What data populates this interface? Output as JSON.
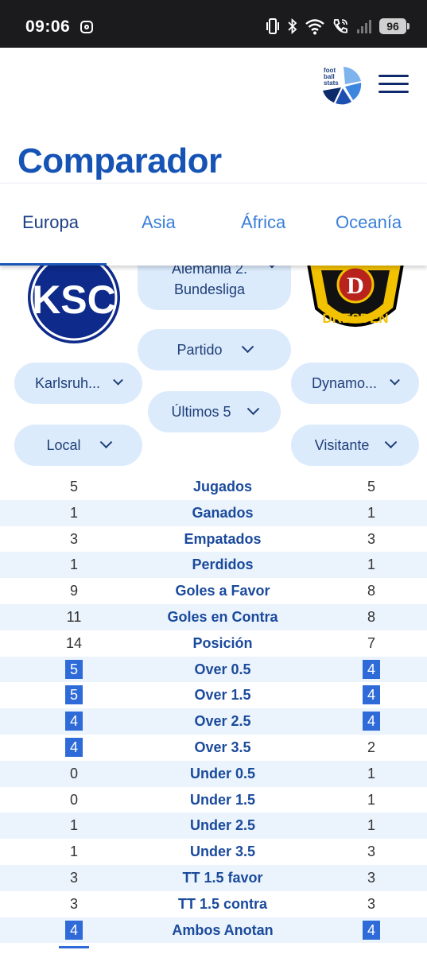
{
  "status_bar": {
    "time": "09:06",
    "battery": "96",
    "icons": [
      "instagram-icon",
      "vibrate-icon",
      "bluetooth-icon",
      "wifi-icon",
      "wifi-call-icon",
      "signal-icon",
      "battery-icon"
    ]
  },
  "header": {
    "logo_text": [
      "foot",
      "ball",
      "stats"
    ],
    "title": "Comparador"
  },
  "tabs": [
    {
      "label": "Europa",
      "active": true
    },
    {
      "label": "Asia",
      "active": false
    },
    {
      "label": "África",
      "active": false
    },
    {
      "label": "Oceanía",
      "active": false
    }
  ],
  "selectors": {
    "league": "Alemania 2. Bundesliga",
    "mode": "Partido",
    "range": "Últimos 5",
    "home_team": "Karlsruh...",
    "away_team": "Dynamo...",
    "home_side": "Local",
    "away_side": "Visitante"
  },
  "crests": {
    "home": "KSC",
    "away_letter": "D",
    "away_name": "DRESDEN"
  },
  "colors": {
    "primary": "#1553b5",
    "pill_bg": "#dcebfc",
    "row_alt": "#ebf3fc",
    "highlight": "#2f6bd8"
  },
  "stats": [
    {
      "label": "Jugados",
      "home": "5",
      "away": "5",
      "home_hl": false,
      "away_hl": false
    },
    {
      "label": "Ganados",
      "home": "1",
      "away": "1",
      "home_hl": false,
      "away_hl": false
    },
    {
      "label": "Empatados",
      "home": "3",
      "away": "3",
      "home_hl": false,
      "away_hl": false
    },
    {
      "label": "Perdidos",
      "home": "1",
      "away": "1",
      "home_hl": false,
      "away_hl": false
    },
    {
      "label": "Goles a Favor",
      "home": "9",
      "away": "8",
      "home_hl": false,
      "away_hl": false
    },
    {
      "label": "Goles en Contra",
      "home": "11",
      "away": "8",
      "home_hl": false,
      "away_hl": false
    },
    {
      "label": "Posición",
      "home": "14",
      "away": "7",
      "home_hl": false,
      "away_hl": false
    },
    {
      "label": "Over 0.5",
      "home": "5",
      "away": "4",
      "home_hl": true,
      "away_hl": true
    },
    {
      "label": "Over 1.5",
      "home": "5",
      "away": "4",
      "home_hl": true,
      "away_hl": true
    },
    {
      "label": "Over 2.5",
      "home": "4",
      "away": "4",
      "home_hl": true,
      "away_hl": true
    },
    {
      "label": "Over 3.5",
      "home": "4",
      "away": "2",
      "home_hl": true,
      "away_hl": false
    },
    {
      "label": "Under 0.5",
      "home": "0",
      "away": "1",
      "home_hl": false,
      "away_hl": false
    },
    {
      "label": "Under 1.5",
      "home": "0",
      "away": "1",
      "home_hl": false,
      "away_hl": false
    },
    {
      "label": "Under 2.5",
      "home": "1",
      "away": "1",
      "home_hl": false,
      "away_hl": false
    },
    {
      "label": "Under 3.5",
      "home": "1",
      "away": "3",
      "home_hl": false,
      "away_hl": false
    },
    {
      "label": "TT 1.5 favor",
      "home": "3",
      "away": "3",
      "home_hl": false,
      "away_hl": false
    },
    {
      "label": "TT 1.5 contra",
      "home": "3",
      "away": "3",
      "home_hl": false,
      "away_hl": false
    },
    {
      "label": "Ambos Anotan",
      "home": "4",
      "away": "4",
      "home_hl": true,
      "away_hl": true
    }
  ]
}
